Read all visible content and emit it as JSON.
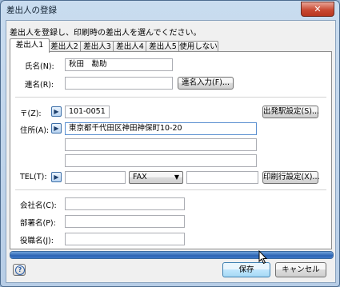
{
  "window": {
    "title": "差出人の登録",
    "close_label": "✕"
  },
  "instruction": "差出人を登録し、印刷時の差出人を選んでください。",
  "tabs": [
    "差出人1",
    "差出人2",
    "差出人3",
    "差出人4",
    "差出人5",
    "使用しない"
  ],
  "active_tab": 0,
  "form": {
    "name_label": "氏名(N):",
    "name_value": "秋田　勘助",
    "joint_name_label": "連名(R):",
    "joint_name_value": "",
    "joint_name_button": "連名入力(F)...",
    "postal_label": "〒(Z):",
    "postal_value": "101-0051",
    "origin_station_button": "出発駅設定(S)...",
    "address_label": "住所(A):",
    "address_line1": "東京都千代田区神田神保町10-20",
    "address_line2": "",
    "address_line3": "",
    "tel_label": "TEL(T):",
    "tel_value": "",
    "fax_select_value": "FAX",
    "fax_value": "",
    "print_line_button": "印刷行設定(X)...",
    "company_label": "会社名(C):",
    "company_value": "",
    "department_label": "部署名(P):",
    "department_value": "",
    "position_label": "役職名(J):",
    "position_value": ""
  },
  "progress_fraction": 1.0,
  "footer": {
    "save_button": "保存",
    "cancel_button": "キャンセル",
    "help_symbol": "?"
  },
  "icons": {
    "arrow": "▶",
    "caret": "▼"
  }
}
